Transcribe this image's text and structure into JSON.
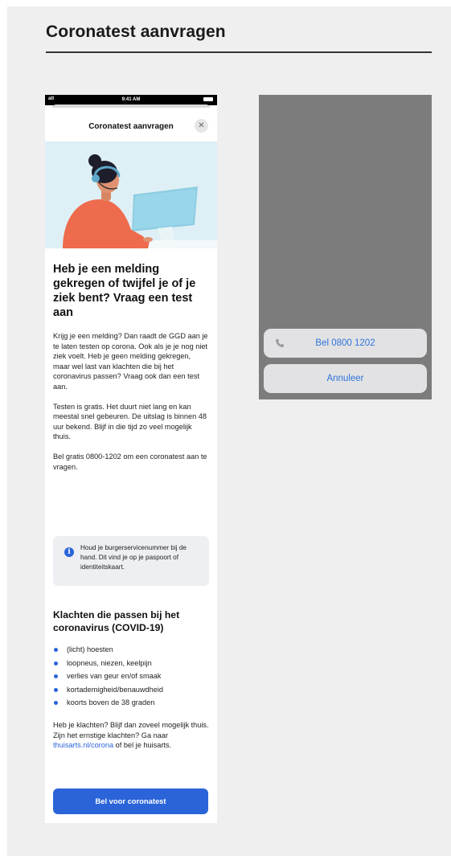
{
  "page": {
    "title": "Coronatest aanvragen"
  },
  "statusbar": {
    "time": "9:41 AM",
    "signal": "atl"
  },
  "sheet": {
    "title": "Coronatest aanvragen",
    "close_icon": "close-icon"
  },
  "content": {
    "heading": "Heb je een melding gekregen of twijfel je of je ziek bent? Vraag een test aan",
    "paragraph1": "Krijg je een melding? Dan raadt de GGD aan je te laten testen op corona. Ook als je je nog niet ziek voelt. Heb je geen melding gekregen, maar wel last van klachten die bij het coronavirus passen? Vraag ook dan een test aan.",
    "paragraph2": "Testen is gratis. Het duurt niet lang en kan meestal snel gebeuren. De uitslag is binnen 48 uur bekend. Blijf in die tijd zo veel mogelijk thuis.",
    "paragraph3": "Bel gratis 0800-1202 om een coronatest aan te vragen.",
    "info": "Houd je burgerservicenummer bij de hand. Dit vind je op je paspoort of identiteitskaart.",
    "symptoms_heading": "Klachten die passen bij het coronavirus (COVID-19)",
    "symptoms": [
      "(licht) hoesten",
      "loopneus, niezen, keelpijn",
      "verlies van geur en/of smaak",
      "kortademigheid/benauwdheid",
      "koorts boven de 38 graden"
    ],
    "closing_text": "Heb je klachten? Blijf dan zoveel mogelijk thuis. Zijn het ernstige klachten? Ga naar ",
    "closing_link": "thuisarts.nl/corona",
    "closing_suffix": " of bel je huisarts.",
    "cta": "Bel voor coronatest"
  },
  "call_sheet": {
    "call_label": "Bel 0800 1202",
    "cancel_label": "Annuleer",
    "icon": "phone-icon"
  },
  "colors": {
    "accent": "#2a64d8",
    "board": "#efefef",
    "overlay": "#7c7c7c",
    "hero_bg": "#def0f5"
  }
}
